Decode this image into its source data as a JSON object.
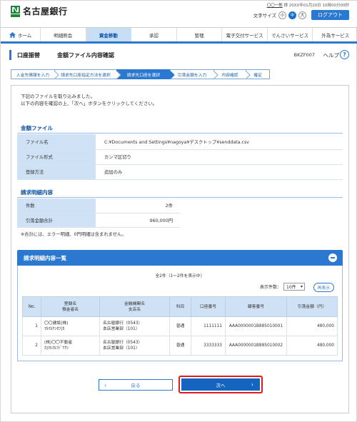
{
  "header": {
    "bank_name": "名古屋銀行",
    "user_name": "〇〇一郎",
    "user_suffix": "様",
    "login_info": "20XX年01月20日 10時00分00秒",
    "font_size_label": "文字サイズ",
    "font_sizes": [
      "小",
      "中",
      "大"
    ],
    "logout_label": "ログアウト"
  },
  "nav": {
    "items": [
      "ホーム",
      "明細照会",
      "資金移動",
      "承認",
      "管理",
      "電子交付サービス",
      "でんさいサービス",
      "外為サービス"
    ],
    "active_index": 2
  },
  "title": {
    "category": "口座振替",
    "page": "金額ファイル内容確認",
    "screen_code": "BKZF007",
    "help_label": "ヘルプ"
  },
  "steps": [
    "入金先情報を入力",
    "請求先口座指定方法を選択",
    "請求先口座を選択",
    "引落金額を入力",
    "内容確認",
    "確定"
  ],
  "active_step": 2,
  "message": {
    "line1": "下記のファイルを取り込みました。",
    "line2": "以下の内容を確認の上、「次へ」ボタンをクリックしてください。"
  },
  "file_section": {
    "title": "金額ファイル",
    "rows": [
      {
        "label": "ファイル名",
        "value": "C:¥Documents and Settings¥nagoya¥デスクトップ¥senddata.csv"
      },
      {
        "label": "ファイル形式",
        "value": "カンマ区切り"
      },
      {
        "label": "登録方法",
        "value": "追加のみ"
      }
    ]
  },
  "detail_section": {
    "title": "請求明細内容",
    "rows": [
      {
        "label": "件数",
        "value": "2件"
      },
      {
        "label": "引落金額合計",
        "value": "960,000円"
      }
    ],
    "note": "※合計には、エラー明細、0円明細は含まれません。"
  },
  "list_section": {
    "title": "請求明細内容一覧",
    "count_text": "全2件（1～2件を表示中）",
    "per_page_label": "表示件数：",
    "per_page_value": "10件",
    "redisplay_label": "再表示",
    "columns": {
      "no": "No.",
      "name1": "登録名",
      "name2": "預金者名",
      "bank1": "金融機関名",
      "bank2": "支店名",
      "type": "科目",
      "account": "口座番号",
      "customer": "顧客番号",
      "amount": "引落金額（円）"
    },
    "rows": [
      {
        "no": "1",
        "name": "〇〇建設(株)",
        "kana": "ﾏﾙﾏﾙｹﾝｾﾂ(ｶ",
        "bank": "名古屋銀行（0543）",
        "branch": "本店営業部（101）",
        "type": "普通",
        "account": "1111111",
        "customer": "AAA0000001B885010001",
        "amount": "480,000"
      },
      {
        "no": "2",
        "name": "(株)〇〇不動産",
        "kana": "ｶ)ﾏﾙﾏﾙﾌﾄﾞｳｻﾝ",
        "bank": "名古屋銀行（0543）",
        "branch": "本店営業部（101）",
        "type": "普通",
        "account": "3333333",
        "customer": "AAA0000001B885010002",
        "amount": "480,000"
      }
    ]
  },
  "buttons": {
    "back": "戻る",
    "next": "次へ"
  },
  "colors": {
    "accent": "#2a78cf",
    "highlight": "#e0191e",
    "label_bg": "#cfe1f5"
  }
}
